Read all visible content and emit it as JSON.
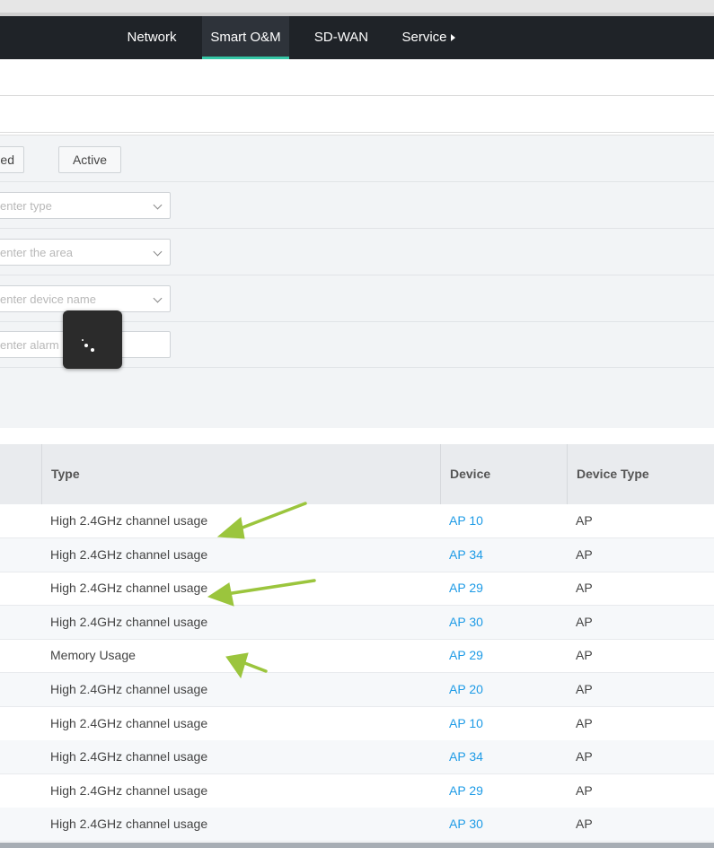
{
  "nav": {
    "items": [
      {
        "label": "Network",
        "active": false
      },
      {
        "label": "Smart O&M",
        "active": true
      },
      {
        "label": "SD-WAN",
        "active": false
      },
      {
        "label": "Service",
        "active": false
      }
    ],
    "accent": "#35c6a6",
    "background": "#1f2328"
  },
  "filters": {
    "status_buttons": [
      "ed",
      "Active"
    ],
    "type_placeholder": "enter type",
    "area_placeholder": "enter the area",
    "device_placeholder": "enter device name",
    "alarm_placeholder": "enter alarm i"
  },
  "table": {
    "columns": [
      "Type",
      "Device",
      "Device Type"
    ],
    "rows": [
      {
        "type": "High 2.4GHz channel usage",
        "device": "AP 10",
        "device_type": "AP"
      },
      {
        "type": "High 2.4GHz channel usage",
        "device": "AP 34",
        "device_type": "AP"
      },
      {
        "type": "High 2.4GHz channel usage",
        "device": "AP 29",
        "device_type": "AP"
      },
      {
        "type": "High 2.4GHz channel usage",
        "device": "AP 30",
        "device_type": "AP"
      },
      {
        "type": "Memory Usage",
        "device": "AP 29",
        "device_type": "AP"
      },
      {
        "type": "High 2.4GHz channel usage",
        "device": "AP 20",
        "device_type": "AP"
      },
      {
        "type": "High 2.4GHz channel usage",
        "device": "AP 10",
        "device_type": "AP"
      },
      {
        "type": "High 2.4GHz channel usage",
        "device": "AP 34",
        "device_type": "AP"
      },
      {
        "type": "High 2.4GHz channel usage",
        "device": "AP 29",
        "device_type": "AP"
      },
      {
        "type": "High 2.4GHz channel usage",
        "device": "AP 30",
        "device_type": "AP"
      }
    ],
    "link_color": "#1e9be6"
  },
  "annotation_color": "#9bc53d"
}
